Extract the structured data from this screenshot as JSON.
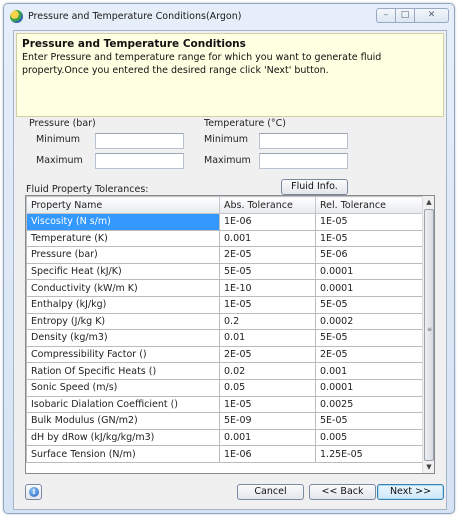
{
  "window": {
    "title": "Pressure and Temperature Conditions(Argon)",
    "controls": {
      "minimize": "–",
      "maximize": "□",
      "close": "✕"
    }
  },
  "banner": {
    "title": "Pressure and Temperature Conditions",
    "description": "Enter Pressure and temperature range for which you want to generate fluid property.Once you entered the desired range click 'Next' button."
  },
  "pressure": {
    "label": "Pressure (bar)",
    "min_label": "Minimum",
    "max_label": "Maximum",
    "min_value": "",
    "max_value": ""
  },
  "temperature": {
    "label": "Temperature (°C)",
    "min_label": "Minimum",
    "max_label": "Maximum",
    "min_value": "",
    "max_value": ""
  },
  "tolerances": {
    "label": "Fluid Property Tolerances:",
    "fluid_info_button": "Fluid Info.",
    "columns": [
      "Property Name",
      "Abs. Tolerance",
      "Rel. Tolerance"
    ],
    "rows": [
      [
        "Viscosity (N s/m)",
        "1E-06",
        "1E-05"
      ],
      [
        "Temperature (K)",
        "0.001",
        "1E-05"
      ],
      [
        "Pressure (bar)",
        "2E-05",
        "5E-06"
      ],
      [
        "Specific Heat (kJ/K)",
        "5E-05",
        "0.0001"
      ],
      [
        "Conductivity (kW/m K)",
        "1E-10",
        "0.0001"
      ],
      [
        "Enthalpy (kJ/kg)",
        "1E-05",
        "5E-05"
      ],
      [
        "Entropy (J/kg K)",
        "0.2",
        "0.0002"
      ],
      [
        "Density (kg/m3)",
        "0.01",
        "5E-05"
      ],
      [
        "Compressibility Factor ()",
        "2E-05",
        "2E-05"
      ],
      [
        "Ration Of Specific Heats ()",
        "0.02",
        "0.001"
      ],
      [
        "Sonic Speed (m/s)",
        "0.05",
        "0.0001"
      ],
      [
        "Isobaric Dialation Coefficient ()",
        "1E-05",
        "0.0025"
      ],
      [
        "Bulk Modulus (GN/m2)",
        "5E-09",
        "5E-05"
      ],
      [
        "dH by dRow (kJ/kg/kg/m3)",
        "0.001",
        "0.005"
      ],
      [
        "Surface Tension (N/m)",
        "1E-06",
        "1.25E-05"
      ]
    ],
    "selected_row": 0
  },
  "footer": {
    "cancel": "Cancel",
    "back": "<< Back",
    "next": "Next >>",
    "info_icon": "i"
  },
  "colors": {
    "selection": "#3399ff",
    "banner": "#ffffe1"
  }
}
